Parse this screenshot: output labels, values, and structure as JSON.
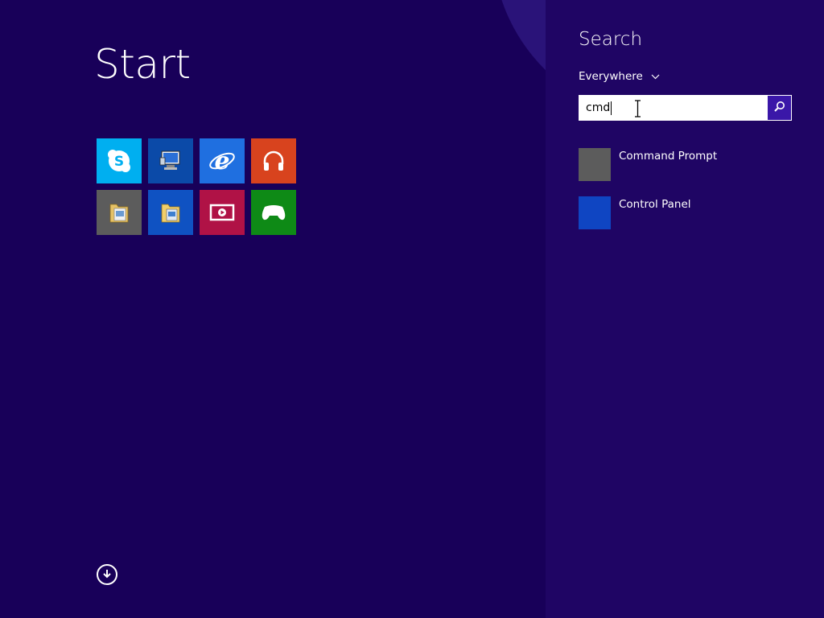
{
  "start": {
    "title": "Start",
    "tiles": [
      {
        "name": "skype",
        "color": "#00aff0",
        "icon": "skype-icon"
      },
      {
        "name": "desktop",
        "color": "#0b4aa8",
        "icon": "desktop-icon"
      },
      {
        "name": "internet-explorer",
        "color": "#1f6fe0",
        "icon": "internet-explorer-icon"
      },
      {
        "name": "music",
        "color": "#d8431e",
        "icon": "headphones-icon"
      },
      {
        "name": "file-manager",
        "color": "#5c5c5c",
        "icon": "folder-icon"
      },
      {
        "name": "file-explorer",
        "color": "#0f52c2",
        "icon": "folder-icon"
      },
      {
        "name": "video",
        "color": "#b01246",
        "icon": "video-icon"
      },
      {
        "name": "games",
        "color": "#0e8a16",
        "icon": "game-controller-icon"
      }
    ],
    "all_apps_icon": "arrow-down-circle-icon"
  },
  "search": {
    "title": "Search",
    "scope": "Everywhere",
    "query": "cmd",
    "go_icon": "search-icon",
    "results": [
      {
        "label": "Command Prompt",
        "color": "#5c5c5c"
      },
      {
        "label": "Control Panel",
        "color": "#0f45c2"
      }
    ]
  },
  "colors": {
    "background": "#180059",
    "search_pane": "#1f0564",
    "search_button": "#3a17a8"
  }
}
